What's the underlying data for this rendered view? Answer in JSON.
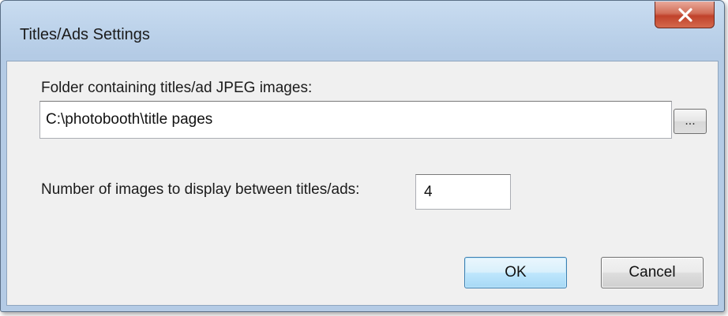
{
  "window": {
    "title": "Titles/Ads Settings"
  },
  "icons": {
    "close": "close-icon"
  },
  "folder": {
    "label": "Folder containing titles/ad JPEG images:",
    "value": "C:\\photobooth\\title pages",
    "browse_label": "..."
  },
  "count": {
    "label": "Number of images to display between titles/ads:",
    "value": "4"
  },
  "buttons": {
    "ok": "OK",
    "cancel": "Cancel"
  },
  "colors": {
    "titlebar": "#bcd2ea",
    "close_button": "#c0422b",
    "ok_button_border": "#3c7fb1"
  }
}
